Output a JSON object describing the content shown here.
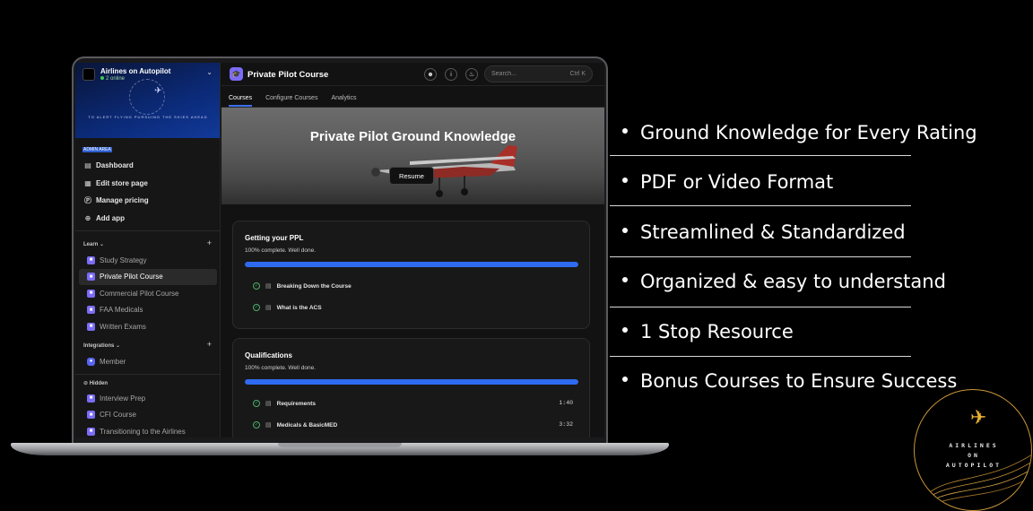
{
  "sidebar": {
    "community_name": "Airlines on Autopilot",
    "online": "2 online",
    "banner_tagline": "TO ALERT FLYING PURSUING THE SKIES AHEAD",
    "admin_label": "ADMIN AREA",
    "admin_items": [
      {
        "label": "Dashboard",
        "icon": "dashboard-icon"
      },
      {
        "label": "Edit store page",
        "icon": "store-icon"
      },
      {
        "label": "Manage pricing",
        "icon": "dollar-icon"
      },
      {
        "label": "Add app",
        "icon": "plus-circle-icon"
      }
    ],
    "learn_label": "Learn",
    "learn_items": [
      "Study Strategy",
      "Private Pilot Course",
      "Commercial Pilot Course",
      "FAA Medicals",
      "Written Exams"
    ],
    "active_item": "Private Pilot Course",
    "integrations_label": "Integrations",
    "integration_items": [
      "Member"
    ],
    "hidden_label": "Hidden",
    "hidden_items": [
      "Interview Prep",
      "CFI Course",
      "Transitioning to the Airlines"
    ]
  },
  "main": {
    "course_title": "Private Pilot Course",
    "search_placeholder": "Search...",
    "search_shortcut": "Ctrl K",
    "tabs": [
      "Courses",
      "Configure Courses",
      "Analytics"
    ],
    "hero_title": "Private Pilot Ground Knowledge",
    "resume_label": "Resume",
    "modules": [
      {
        "title": "Getting your PPL",
        "status": "100% complete. Well done.",
        "progress": 1.0,
        "lessons": [
          {
            "title": "Breaking Down the Course",
            "duration": ""
          },
          {
            "title": "What is the ACS",
            "duration": ""
          }
        ]
      },
      {
        "title": "Qualifications",
        "status": "100% complete. Well done.",
        "progress": 1.0,
        "lessons": [
          {
            "title": "Requirements",
            "duration": "1:40"
          },
          {
            "title": "Medicals & BasicMED",
            "duration": "3:32"
          }
        ]
      }
    ]
  },
  "features": [
    "Ground Knowledge for Every Rating",
    "PDF or Video Format",
    "Streamlined & Standardized",
    "Organized & easy to understand",
    "1 Stop Resource",
    "Bonus Courses to Ensure Success"
  ],
  "brand": {
    "line1": "AIRLINES",
    "line2": "ON",
    "line3": "AUTOPILOT",
    "accent_color": "#e9b233"
  },
  "colors": {
    "accent_blue": "#2f6bf0",
    "course_icon": "#7b6cf6"
  }
}
